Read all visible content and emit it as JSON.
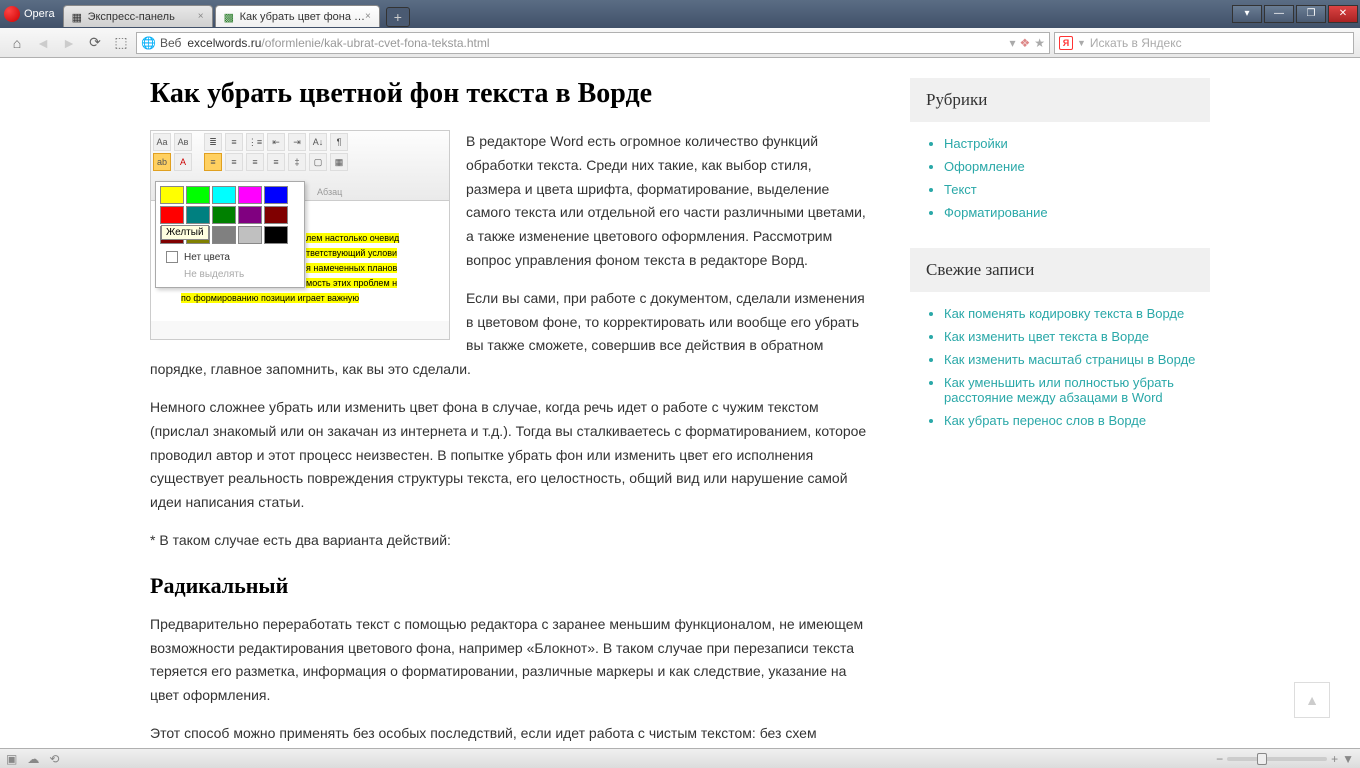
{
  "titlebar": {
    "opera": "Opera",
    "tabs": [
      {
        "label": "Экспресс-панель"
      },
      {
        "label": "Как убрать цвет фона …"
      }
    ],
    "new_tab": "+"
  },
  "toolbar": {
    "web_label": "Веб",
    "url_host": "excelwords.ru",
    "url_path": "/oformlenie/kak-ubrat-cvet-fona-teksta.html",
    "search_placeholder": "Искать в Яндекс",
    "yandex_badge": "Я"
  },
  "article": {
    "h1": "Как убрать цветной фон текста в Ворде",
    "p1": "В редакторе Word есть огромное количество функций обработки текста. Среди них такие, как выбор стиля, размера и цвета шрифта, форматирование, выделение самого текста или отдельной его части различными цветами, а также изменение цветового оформления. Рассмотрим вопрос управления фоном текста в редакторе Ворд.",
    "p2": "Если вы сами, при работе с документом, сделали изменения в цветовом фоне, то корректировать или вообще его убрать вы также сможете, совершив все действия в обратном порядке, главное запомнить, как вы это сделали.",
    "p3": "Немного сложнее убрать или изменить цвет фона в случае, когда речь идет о работе с чужим текстом (прислал знакомый или он закачан из интернета и т.д.). Тогда вы сталкиваетесь с форматированием, которое проводил автор и этот процесс неизвестен. В попытке убрать фон или изменить цвет его исполнения существует реальность повреждения структуры текста, его целостность, общий вид или нарушение самой идеи написания статьи.",
    "p4": "* В таком случае есть два варианта действий:",
    "h2": "Радикальный",
    "p5": "Предварительно переработать текст с помощью редактора с заранее меньшим функционалом, не имеющем возможности редактирования цветового фона, например «Блокнот». В таком случае при перезаписи текста теряется его разметка, информация о форматировании, различные маркеры и как следствие, указание на цвет оформления.",
    "p6": "Этот способ можно применять без особых последствий, если идет работа с чистым текстом: без схем"
  },
  "word_shot": {
    "tooltip": "Желтый",
    "no_color": "Нет цвета",
    "no_highlight": "Не выделять",
    "group_label": "Абзац",
    "highlighted_lines": [
      "лем настолько очевид",
      "тветствующий услови",
      "я намеченных планов",
      "мость этих проблем н",
      "по формированию позиции играет важную"
    ],
    "colors_row1": [
      "#ffff00",
      "#00ff00",
      "#00ffff",
      "#ff00ff",
      "#0000ff"
    ],
    "colors_row2": [
      "#ff0000",
      "#008080",
      "#008000",
      "#800080",
      "#800000"
    ],
    "colors_row3": [
      "#800000",
      "#808000",
      "#808080",
      "#c0c0c0",
      "#000000"
    ]
  },
  "sidebar": {
    "rubrics_title": "Рубрики",
    "rubrics": [
      "Настройки",
      "Оформление",
      "Текст",
      "Форматирование"
    ],
    "recent_title": "Свежие записи",
    "recent": [
      "Как поменять кодировку текста в Ворде",
      "Как изменить цвет текста в Ворде",
      "Как изменить масштаб страницы в Ворде",
      "Как уменьшить или полностью убрать расстояние между абзацами в Word",
      "Как убрать перенос слов в Ворде"
    ]
  },
  "status": {
    "minus": "−",
    "plus": "+"
  }
}
